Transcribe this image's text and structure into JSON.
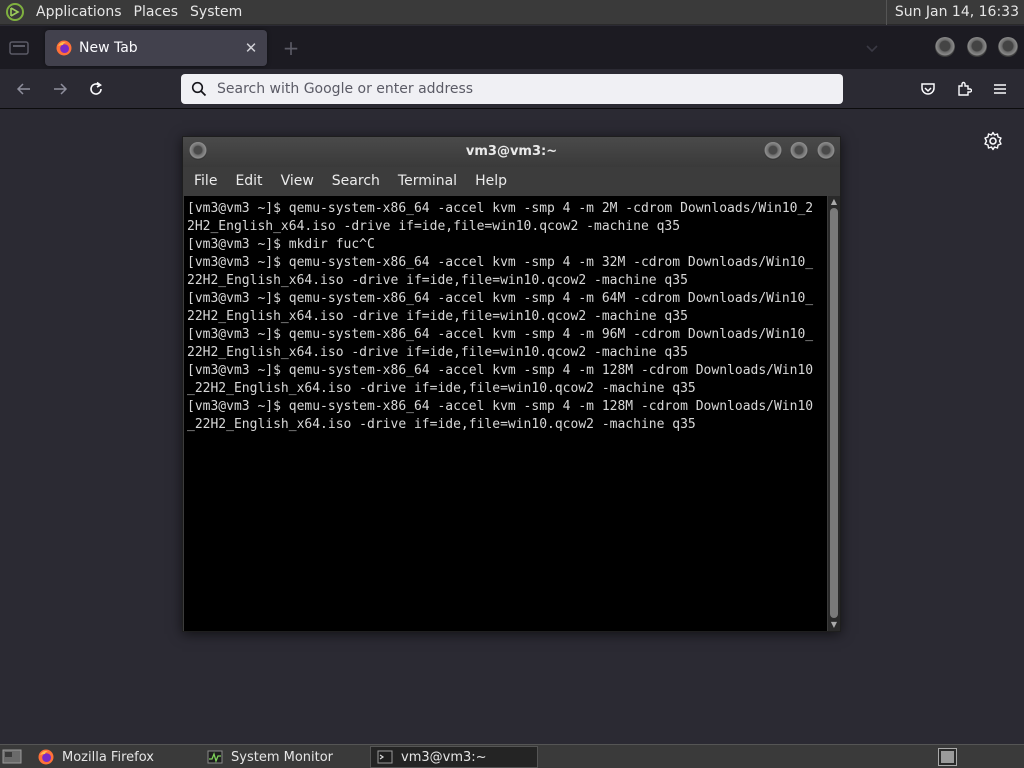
{
  "top_panel": {
    "menus": [
      "Applications",
      "Places",
      "System"
    ],
    "clock": "Sun Jan 14, 16:33"
  },
  "browser": {
    "tab": {
      "title": "New Tab",
      "close_glyph": "✕"
    },
    "new_tab_glyph": "+",
    "urlbar": {
      "placeholder": "Search with Google or enter address",
      "value": ""
    },
    "icons": [
      "list-all-tabs-icon",
      "firefox-icon",
      "back-icon",
      "forward-icon",
      "reload-icon",
      "search-icon",
      "pocket-icon",
      "extensions-icon",
      "menu-icon",
      "gear-icon"
    ]
  },
  "terminal": {
    "title": "vm3@vm3:~",
    "menu": [
      "File",
      "Edit",
      "View",
      "Search",
      "Terminal",
      "Help"
    ],
    "lines": [
      "[vm3@vm3 ~]$ qemu-system-x86_64 -accel kvm -smp 4 -m 2M -cdrom Downloads/Win10_2",
      "2H2_English_x64.iso -drive if=ide,file=win10.qcow2 -machine q35",
      "[vm3@vm3 ~]$ mkdir fuc^C",
      "[vm3@vm3 ~]$ qemu-system-x86_64 -accel kvm -smp 4 -m 32M -cdrom Downloads/Win10_",
      "22H2_English_x64.iso -drive if=ide,file=win10.qcow2 -machine q35",
      "[vm3@vm3 ~]$ qemu-system-x86_64 -accel kvm -smp 4 -m 64M -cdrom Downloads/Win10_",
      "22H2_English_x64.iso -drive if=ide,file=win10.qcow2 -machine q35",
      "[vm3@vm3 ~]$ qemu-system-x86_64 -accel kvm -smp 4 -m 96M -cdrom Downloads/Win10_",
      "22H2_English_x64.iso -drive if=ide,file=win10.qcow2 -machine q35",
      "[vm3@vm3 ~]$ qemu-system-x86_64 -accel kvm -smp 4 -m 128M -cdrom Downloads/Win10",
      "_22H2_English_x64.iso -drive if=ide,file=win10.qcow2 -machine q35",
      "[vm3@vm3 ~]$ qemu-system-x86_64 -accel kvm -smp 4 -m 128M -cdrom Downloads/Win10",
      "_22H2_English_x64.iso -drive if=ide,file=win10.qcow2 -machine q35"
    ]
  },
  "taskbar": {
    "tasks": [
      "Mozilla Firefox",
      "System Monitor",
      "vm3@vm3:~"
    ],
    "active_task": "vm3@vm3:~"
  },
  "colors": {
    "terminal_bg": "#000000",
    "terminal_fg": "#d8d8d8",
    "browser_bg": "#2b2a33",
    "urlbar_bg": "#f0f0f4"
  }
}
